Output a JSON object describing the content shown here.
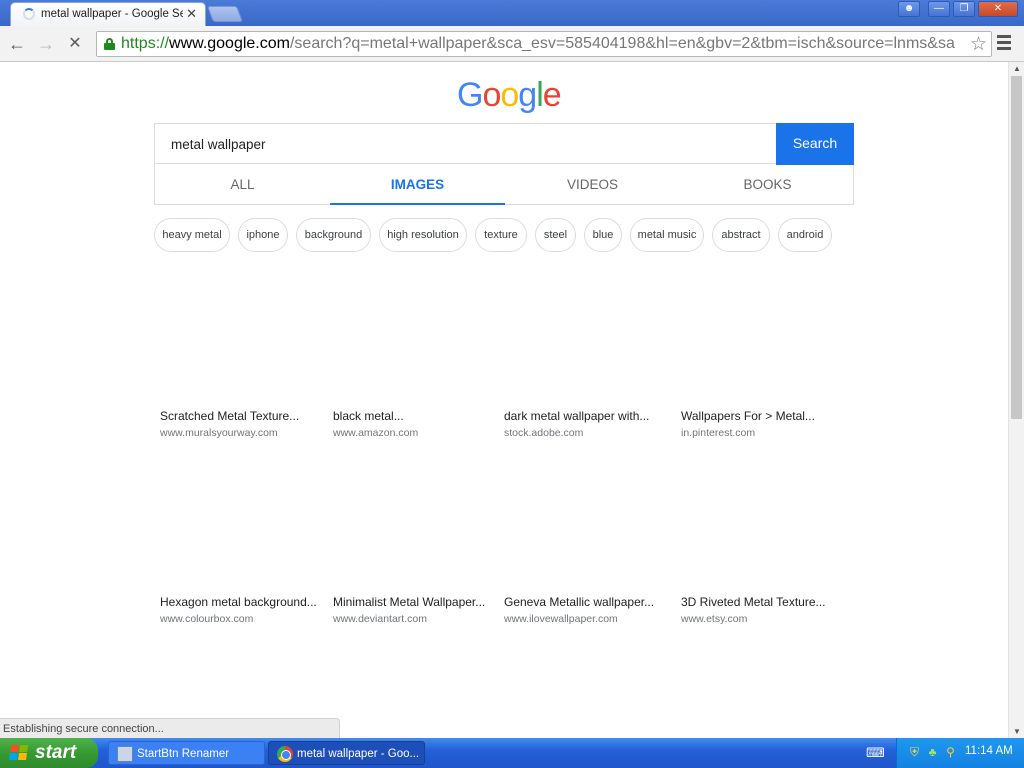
{
  "browser": {
    "tab": {
      "title": "metal wallpaper - Google Se",
      "close_icon": "✕"
    },
    "window_buttons": {
      "user": "user-icon",
      "minimize": "—",
      "maximize": "❐",
      "close": "✕"
    },
    "toolbar": {
      "back": "←",
      "forward": "→",
      "stop": "✕",
      "url": {
        "scheme": "https://",
        "host": "www.google.com",
        "path": "/search?q=metal+wallpaper&sca_esv=585404198&hl=en&gbv=2&tbm=isch&source=lnms&sa"
      },
      "star": "☆"
    },
    "status_text": "Establishing secure connection..."
  },
  "page": {
    "logo": {
      "letters": [
        "G",
        "o",
        "o",
        "g",
        "l",
        "e"
      ]
    },
    "search": {
      "query": "metal wallpaper",
      "button_label": "Search"
    },
    "tabs": [
      {
        "label": "ALL",
        "active": false
      },
      {
        "label": "IMAGES",
        "active": true
      },
      {
        "label": "VIDEOS",
        "active": false
      },
      {
        "label": "BOOKS",
        "active": false
      }
    ],
    "chips": [
      "heavy metal",
      "iphone",
      "background",
      "high resolution",
      "texture",
      "steel",
      "blue",
      "metal music",
      "abstract",
      "android"
    ],
    "results": [
      {
        "title": "Scratched Metal Texture...",
        "source": "www.muralsyourway.com"
      },
      {
        "title": "black metal...",
        "source": "www.amazon.com"
      },
      {
        "title": "dark metal wallpaper with...",
        "source": "stock.adobe.com"
      },
      {
        "title": "Wallpapers For > Metal...",
        "source": "in.pinterest.com"
      },
      {
        "title": "Hexagon metal background...",
        "source": "www.colourbox.com"
      },
      {
        "title": "Minimalist Metal Wallpaper...",
        "source": "www.deviantart.com"
      },
      {
        "title": "Geneva Metallic wallpaper...",
        "source": "www.ilovewallpaper.com"
      },
      {
        "title": "3D Riveted Metal Texture...",
        "source": "www.etsy.com"
      }
    ]
  },
  "taskbar": {
    "start_label": "start",
    "tasks": [
      {
        "label": "StartBtn Renamer",
        "icon": "renamer-icon"
      },
      {
        "label": "metal wallpaper - Goo...",
        "icon": "chrome-icon"
      }
    ],
    "keyboard_icon": "⌨",
    "tray_icons": {
      "shield": "⛨",
      "network": "♣",
      "magnifier": "⚲"
    },
    "clock": "11:14 AM"
  },
  "colors": {
    "accent_blue": "#1a73e8",
    "google_blue": "#4285f4",
    "google_red": "#ea4335",
    "google_yellow": "#fbbc05",
    "google_green": "#34a853",
    "secure_green": "#1e8a1e",
    "xp_taskbar": "#2460d6",
    "xp_start": "#379a33"
  }
}
